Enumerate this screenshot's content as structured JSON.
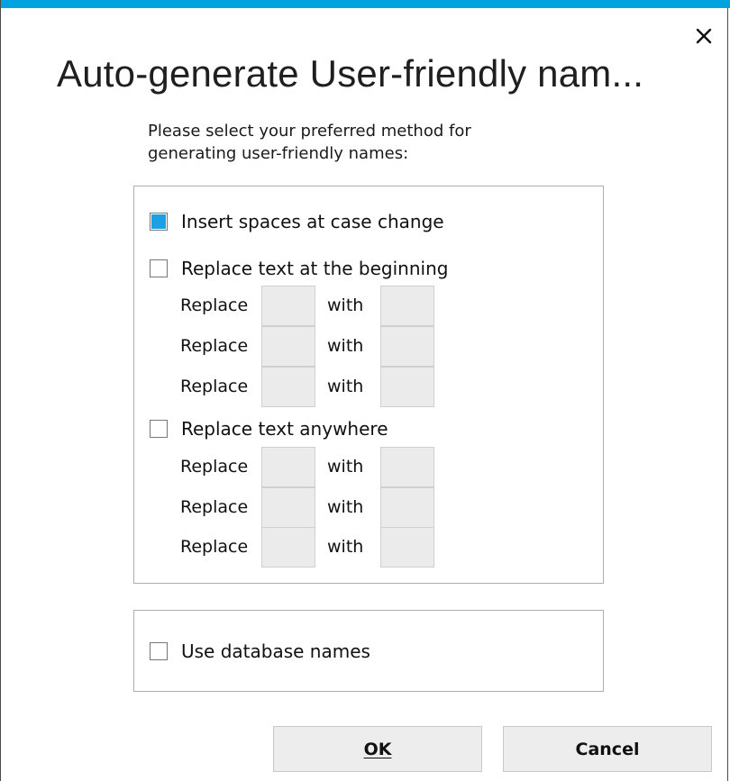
{
  "window": {
    "title": "Auto-generate User-friendly nam...",
    "accent_color": "#00a2e0",
    "close_icon": "close-icon"
  },
  "description": "Please select your preferred method for generating user-friendly names:",
  "options": {
    "insert_spaces": {
      "label": "Insert spaces at case change",
      "checked": true
    },
    "replace_beginning": {
      "label": "Replace text at the beginning",
      "checked": false,
      "rows": [
        {
          "replace_label": "Replace",
          "replace_value": "",
          "with_label": "with",
          "with_value": ""
        },
        {
          "replace_label": "Replace",
          "replace_value": "",
          "with_label": "with",
          "with_value": ""
        },
        {
          "replace_label": "Replace",
          "replace_value": "",
          "with_label": "with",
          "with_value": ""
        }
      ]
    },
    "replace_anywhere": {
      "label": "Replace text anywhere",
      "checked": false,
      "rows": [
        {
          "replace_label": "Replace",
          "replace_value": "",
          "with_label": "with",
          "with_value": ""
        },
        {
          "replace_label": "Replace",
          "replace_value": "",
          "with_label": "with",
          "with_value": ""
        },
        {
          "replace_label": "Replace",
          "replace_value": "",
          "with_label": "with",
          "with_value": ""
        }
      ]
    },
    "use_database_names": {
      "label": "Use database names",
      "checked": false
    }
  },
  "buttons": {
    "ok": "OK",
    "cancel": "Cancel"
  },
  "colors": {
    "check_fill": "#1ba1e2",
    "border": "#adadad",
    "field_bg": "#ebebeb"
  }
}
